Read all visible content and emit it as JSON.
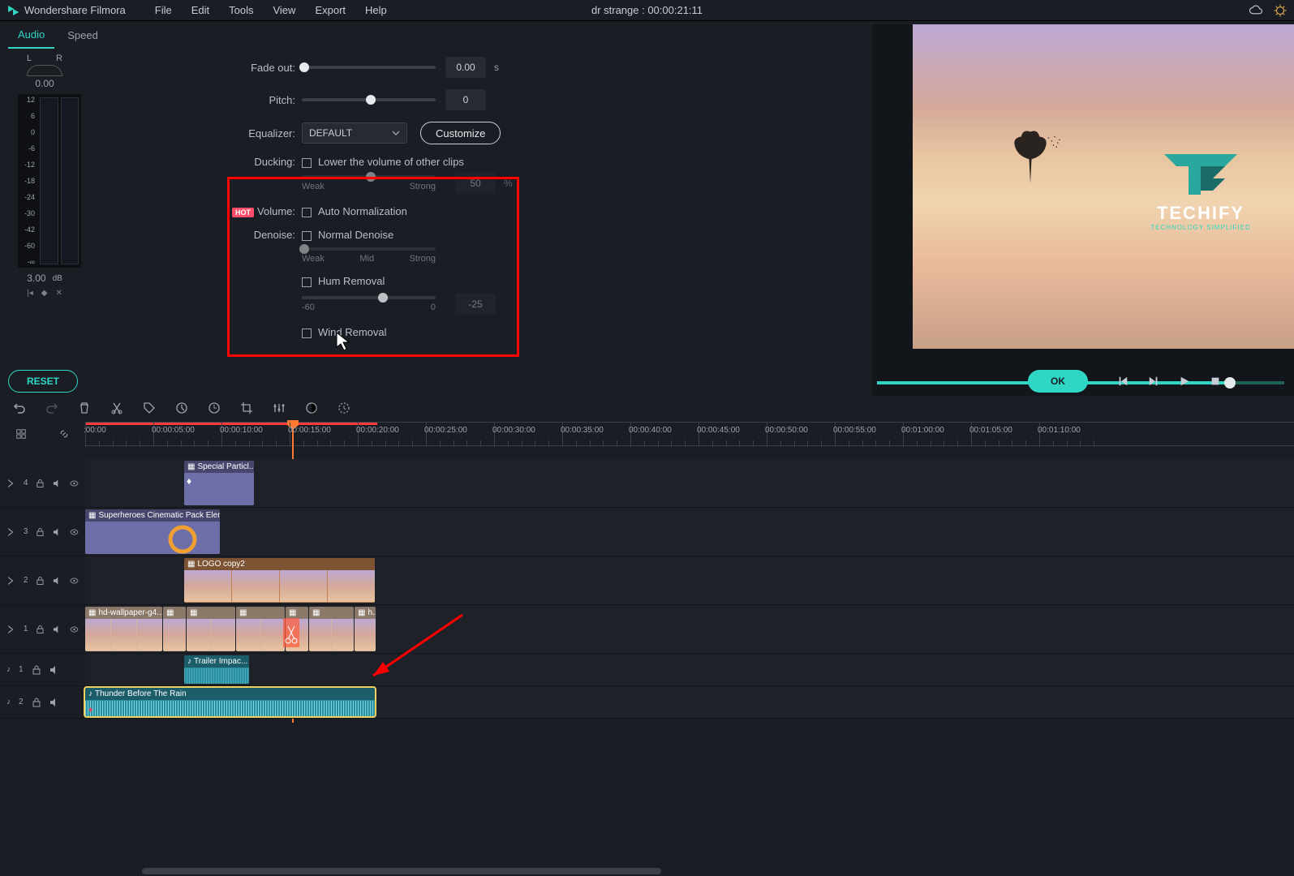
{
  "app": {
    "name": "Wondershare Filmora"
  },
  "menus": [
    "File",
    "Edit",
    "Tools",
    "View",
    "Export",
    "Help"
  ],
  "project": {
    "title": "dr strange : 00:00:21:11"
  },
  "tabs": {
    "audio": "Audio",
    "speed": "Speed"
  },
  "meter": {
    "L": "L",
    "R": "R",
    "pan_value": "0.00",
    "scale": [
      "12",
      "6",
      "0",
      "-6",
      "-12",
      "-18",
      "-24",
      "-30",
      "-42",
      "-60",
      "-∞"
    ],
    "bottom_value": "3.00",
    "db_unit": "dB"
  },
  "audio_props": {
    "fade_out": {
      "label": "Fade out:",
      "value": "0.00",
      "unit": "s"
    },
    "pitch": {
      "label": "Pitch:",
      "value": "0"
    },
    "equalizer": {
      "label": "Equalizer:",
      "selected": "DEFAULT",
      "customize": "Customize"
    },
    "ducking": {
      "label": "Ducking:",
      "check_label": "Lower the volume of other clips",
      "amount": "50",
      "unit": "%",
      "weak": "Weak",
      "strong": "Strong"
    },
    "volume": {
      "label": "Volume:",
      "hot": "HOT",
      "check_label": "Auto Normalization"
    },
    "denoise": {
      "label": "Denoise:",
      "check_label": "Normal Denoise",
      "weak": "Weak",
      "mid": "Mid",
      "strong": "Strong"
    },
    "hum": {
      "check_label": "Hum Removal",
      "value": "-25",
      "min": "-60",
      "max": "0"
    },
    "wind": {
      "check_label": "Wind Removal"
    }
  },
  "actions": {
    "reset": "RESET",
    "ok": "OK"
  },
  "timeline": {
    "ticks": [
      ":00:00",
      "00:00:05:00",
      "00:00:10:00",
      "00:00:15:00",
      "00:00:20:00",
      "00:00:25:00",
      "00:00:30:00",
      "00:00:35:00",
      "00:00:40:00",
      "00:00:45:00",
      "00:00:50:00",
      "00:00:55:00",
      "00:01:00:00",
      "00:01:05:00",
      "00:01:10:00"
    ],
    "playhead_at": "15:00"
  },
  "tracks": {
    "v4": {
      "name": "4"
    },
    "v3": {
      "name": "3"
    },
    "v2": {
      "name": "2"
    },
    "v1": {
      "name": "1"
    },
    "a1": {
      "name": "1"
    },
    "a2": {
      "name": "2"
    }
  },
  "clips": {
    "special": "Special Particl...",
    "superheroes": "Superheroes Cinematic Pack Eleme...",
    "logo": "LOGO copy2",
    "wallpaper": "hd-wallpaper-g4...",
    "h": "h...",
    "trailer": "Trailer Impac...",
    "thunder": "Thunder Before The Rain"
  },
  "preview": {
    "logo_text": "TECHIFY",
    "logo_tagline": "TECHNOLOGY SIMPLIFIED"
  }
}
